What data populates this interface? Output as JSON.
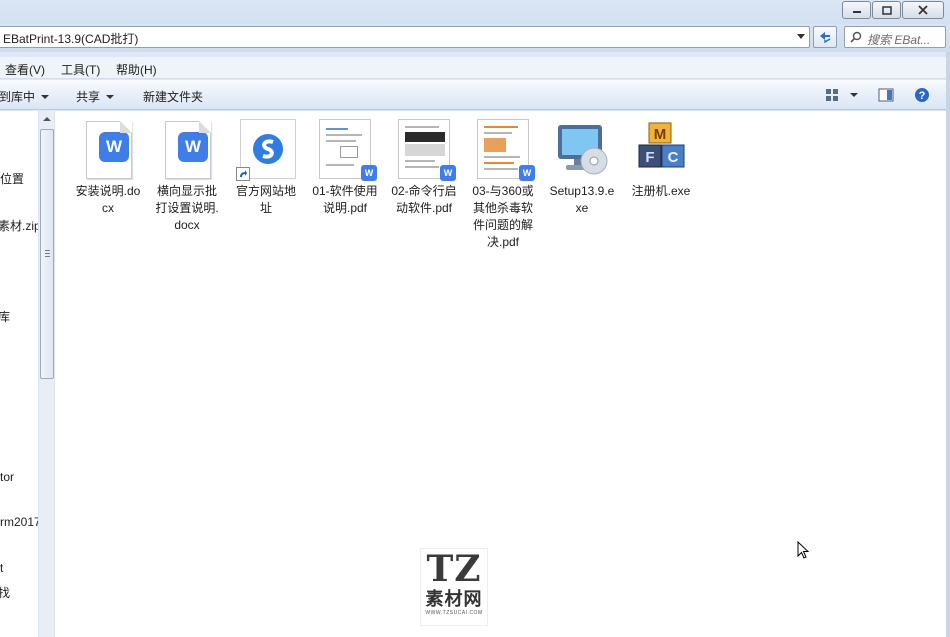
{
  "window": {
    "minimize_label": "–",
    "maximize_label": "□",
    "close_label": "✕"
  },
  "address": {
    "path": "EBatPrint-13.9(CAD批打)",
    "search_placeholder": "搜索 EBat..."
  },
  "menu": {
    "items": [
      {
        "label": "查看(V)"
      },
      {
        "label": "工具(T)"
      },
      {
        "label": "帮助(H)"
      }
    ]
  },
  "toolbar": {
    "include_label": "到库中",
    "share_label": "共享",
    "new_folder_label": "新建文件夹"
  },
  "nav": {
    "items": [
      {
        "label": "位置"
      },
      {
        "label": "素材.zip"
      },
      {
        "label": "库"
      },
      {
        "label": "tor"
      },
      {
        "label": "rm2017"
      },
      {
        "label": "t"
      },
      {
        "label": "找"
      }
    ]
  },
  "files": [
    {
      "name": "安装说明.docx",
      "icon": "wps-word-icon"
    },
    {
      "name": "横向显示批打设置说明.docx",
      "icon": "wps-word-icon"
    },
    {
      "name": "官方网站地址",
      "icon": "url-shortcut-icon"
    },
    {
      "name": "01-软件使用说明.pdf",
      "icon": "pdf-icon"
    },
    {
      "name": "02-命令行启动软件.pdf",
      "icon": "pdf-icon"
    },
    {
      "name": "03-与360或其他杀毒软件问题的解决.pdf",
      "icon": "pdf-icon"
    },
    {
      "name": "Setup13.9.exe",
      "icon": "setup-cd-icon"
    },
    {
      "name": "注册机.exe",
      "icon": "keygen-icon"
    }
  ],
  "watermark": {
    "logo_text": "TZ",
    "name": "素材网",
    "url": "WWW.TZSUCAI.COM"
  },
  "colors": {
    "wps_blue": "#3f7ee8",
    "chrome": "#dfe9f5",
    "selection": "#cce8ff"
  }
}
